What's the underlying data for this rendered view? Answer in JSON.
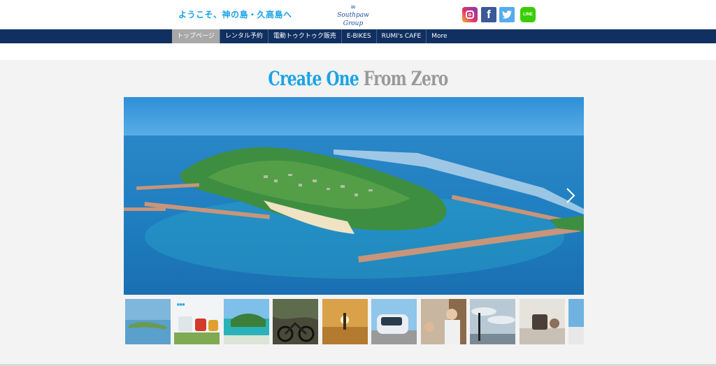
{
  "header": {
    "welcome_text": "ようこそ、神の島・久高島へ",
    "logo_text": "Southpaw Group",
    "social": [
      "instagram-icon",
      "facebook-icon",
      "twitter-icon",
      "line-icon"
    ],
    "line_label": "LINE"
  },
  "nav": {
    "items": [
      {
        "label": "トップページ",
        "active": true
      },
      {
        "label": "レンタル予約",
        "active": false
      },
      {
        "label": "電動トゥクトゥク販売",
        "active": false
      },
      {
        "label": "E-BIKES",
        "active": false
      },
      {
        "label": "RUMI's CAFE",
        "active": false
      },
      {
        "label": "More",
        "active": false
      }
    ]
  },
  "main": {
    "headline_part1": "Create One",
    "headline_part2": "From Zero"
  },
  "gallery": {
    "thumbnail_count": 10,
    "selected_index": 0
  },
  "colors": {
    "accent": "#1aa3e8",
    "nav_bg": "#0f3060",
    "nav_active": "#a8a8a8",
    "headline_gray": "#9a9a9a"
  }
}
